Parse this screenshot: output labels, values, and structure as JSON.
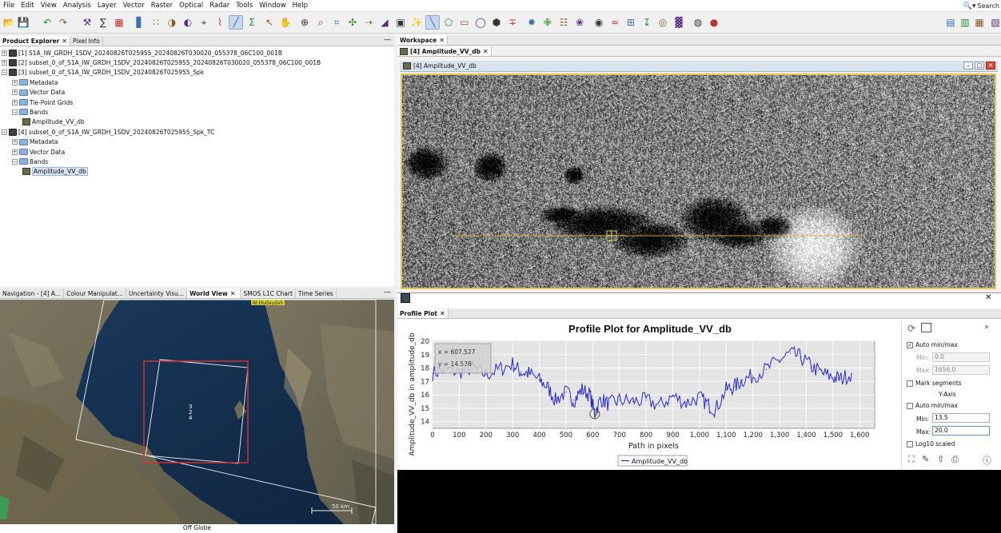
{
  "menu": [
    "File",
    "Edit",
    "View",
    "Analysis",
    "Layer",
    "Vector",
    "Raster",
    "Optical",
    "Radar",
    "Tools",
    "Window",
    "Help"
  ],
  "search": {
    "label": "Search"
  },
  "product_explorer": {
    "tabs": [
      "Product Explorer",
      "Pixel Info"
    ],
    "items": [
      {
        "text": "[1] S1A_IW_GRDH_1SDV_20240826T025955_20240826T030020_055378_06C100_001B",
        "kind": "product",
        "expander": "+"
      },
      {
        "text": "[2] subset_0_of_S1A_IW_GRDH_1SDV_20240826T025955_20240826T030020_055378_06C100_001B",
        "kind": "product",
        "expander": "+"
      },
      {
        "text": "[3] subset_0_of_S1A_IW_GRDH_1SDV_20240826T025955_Spk",
        "kind": "product",
        "expander": "-"
      },
      {
        "text": "Metadata",
        "kind": "folder",
        "expander": "+"
      },
      {
        "text": "Vector Data",
        "kind": "folder",
        "expander": "+"
      },
      {
        "text": "Tie-Point Grids",
        "kind": "folder",
        "expander": "+"
      },
      {
        "text": "Bands",
        "kind": "folder",
        "expander": "-"
      },
      {
        "text": "Amplitude_VV_db",
        "kind": "band",
        "expander": ""
      },
      {
        "text": "[4] subset_0_of_S1A_IW_GRDH_1SDV_20240826T025955_Spk_TC",
        "kind": "product",
        "expander": "-"
      },
      {
        "text": "Metadata",
        "kind": "folder",
        "expander": "+"
      },
      {
        "text": "Vector Data",
        "kind": "folder",
        "expander": "+"
      },
      {
        "text": "Bands",
        "kind": "folder",
        "expander": "-"
      },
      {
        "text": "Amplitude_VV_db",
        "kind": "band",
        "expander": "",
        "selected": true
      }
    ]
  },
  "navigation": {
    "tabs": [
      "Navigation - [4] A...",
      "Colour Manipulat...",
      "Uncertainty Visu...",
      "World View",
      "SMOS L1C Chart",
      "Time Series"
    ],
    "place_label": "Al Hudaydah",
    "footprint_labels": [
      "3",
      "2",
      "4"
    ],
    "scale_label": "50 km",
    "caption": "Off Globe"
  },
  "workspace": {
    "tab": "Workspace",
    "doc_tab": "[4] Amplitude_VV_db",
    "window_title": "[4] Amplitude_VV_db"
  },
  "profile": {
    "tab": "Profile Plot",
    "tooltip": {
      "x": "x = 607.527",
      "y": "y = 14.578"
    },
    "legend": "Amplitude_VV_db",
    "controls": {
      "auto_minmax_x": "Auto min/max",
      "min_label": "Min:",
      "min_x": "0.0",
      "max_label": "Max:",
      "max_x": "1656.0",
      "mark_segments": "Mark segments",
      "y_axis": "Y-Axis",
      "auto_minmax_y": "Auto min/max",
      "min_y": "13.5",
      "max_y": "20.0",
      "log10": "Log10 scaled"
    }
  },
  "chart_data": {
    "type": "line",
    "title": "Profile Plot for Amplitude_VV_db",
    "xlabel": "Path in pixels",
    "ylabel": "Amplitude_VV_db in amplitude_db",
    "xlim": [
      0,
      1656
    ],
    "ylim": [
      13.5,
      20.0
    ],
    "xticks": [
      "0",
      "100",
      "200",
      "300",
      "400",
      "500",
      "600",
      "700",
      "800",
      "900",
      "1,000",
      "1,100",
      "1,200",
      "1,300",
      "1,400",
      "1,500",
      "1,600"
    ],
    "yticks": [
      "14",
      "15",
      "16",
      "17",
      "18",
      "19",
      "20"
    ],
    "series": [
      {
        "name": "Amplitude_VV_db",
        "color": "#2a2acc",
        "x": [
          0,
          50,
          100,
          150,
          200,
          250,
          300,
          330,
          360,
          400,
          430,
          460,
          500,
          530,
          560,
          590,
          607,
          630,
          660,
          700,
          750,
          800,
          850,
          900,
          950,
          1000,
          1030,
          1060,
          1100,
          1130,
          1160,
          1200,
          1250,
          1300,
          1340,
          1380,
          1420,
          1460,
          1500,
          1530,
          1570
        ],
        "y": [
          17.6,
          17.9,
          17.7,
          18.0,
          17.5,
          17.9,
          18.3,
          17.7,
          17.6,
          17.1,
          16.6,
          15.6,
          16.2,
          15.6,
          16.4,
          16.0,
          14.6,
          15.7,
          15.3,
          15.6,
          15.5,
          15.6,
          15.2,
          15.9,
          15.4,
          15.8,
          15.3,
          14.9,
          16.4,
          16.6,
          17.1,
          17.4,
          17.9,
          18.6,
          19.1,
          18.8,
          18.1,
          17.6,
          17.3,
          17.2,
          17.6
        ]
      }
    ]
  },
  "colors": {
    "accent_selection": "#e3c65a",
    "plot_line": "#2a2acc",
    "footprint_selected": "#e03030"
  }
}
